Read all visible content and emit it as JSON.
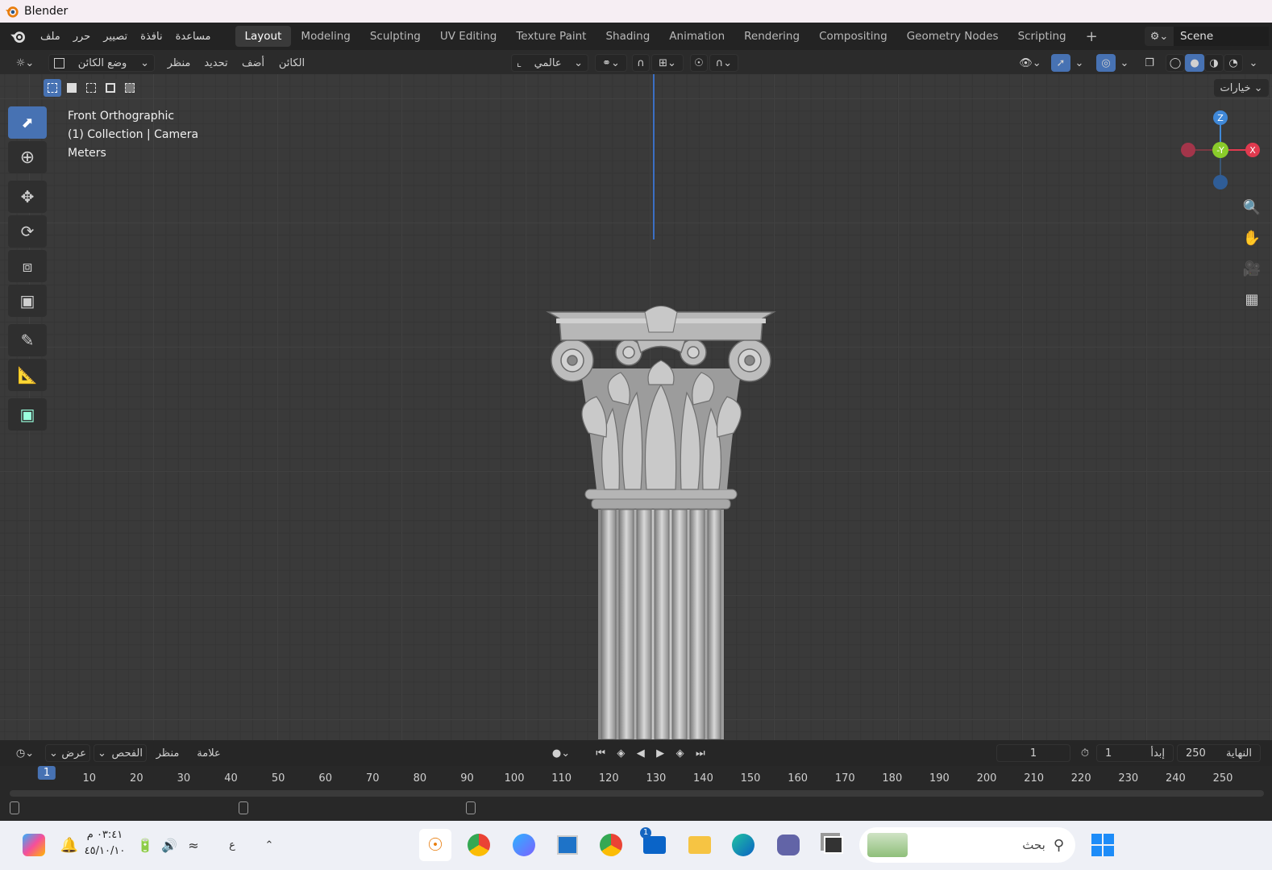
{
  "window": {
    "title": "Blender"
  },
  "menu": {
    "items": [
      "ملف",
      "حرر",
      "تصيير",
      "نافذة",
      "مساعدة"
    ]
  },
  "workspaces": [
    "Layout",
    "Modeling",
    "Sculpting",
    "UV Editing",
    "Texture Paint",
    "Shading",
    "Animation",
    "Rendering",
    "Compositing",
    "Geometry Nodes",
    "Scripting"
  ],
  "scene": {
    "name": "Scene"
  },
  "header": {
    "mode": "وضع الكائن",
    "view": "منظر",
    "select": "تحديد",
    "add": "أضف",
    "object": "الكائن",
    "orientation": "عالمي",
    "options": "خيارات"
  },
  "viewport": {
    "view_name": "Front Orthographic",
    "collection": "(1) Collection | Camera",
    "units": "Meters",
    "gizmo": {
      "z": "Z",
      "y": "-Y",
      "x": "X"
    }
  },
  "timeline": {
    "menu": {
      "view": "عرض",
      "inspect": "الفحص",
      "look": "منظر",
      "marker": "علامة"
    },
    "current_frame": "1",
    "start_label": "إبدأ",
    "start": "1",
    "end_label": "النهاية",
    "end": "250",
    "ticks": [
      "1",
      "10",
      "20",
      "30",
      "40",
      "50",
      "60",
      "70",
      "80",
      "90",
      "100",
      "110",
      "120",
      "130",
      "140",
      "150",
      "160",
      "170",
      "180",
      "190",
      "200",
      "210",
      "220",
      "230",
      "240",
      "250"
    ]
  },
  "taskbar": {
    "time": "٠٣:٤١ م",
    "date": "٤٥/١٠/١٠",
    "lang": "ع",
    "search_placeholder": "بحث",
    "mail_badge": "1"
  },
  "colors": {
    "accent": "#4772b3",
    "x_axis": "#e03a4f",
    "y_axis": "#8acb2a",
    "z_axis": "#3f88d8"
  }
}
